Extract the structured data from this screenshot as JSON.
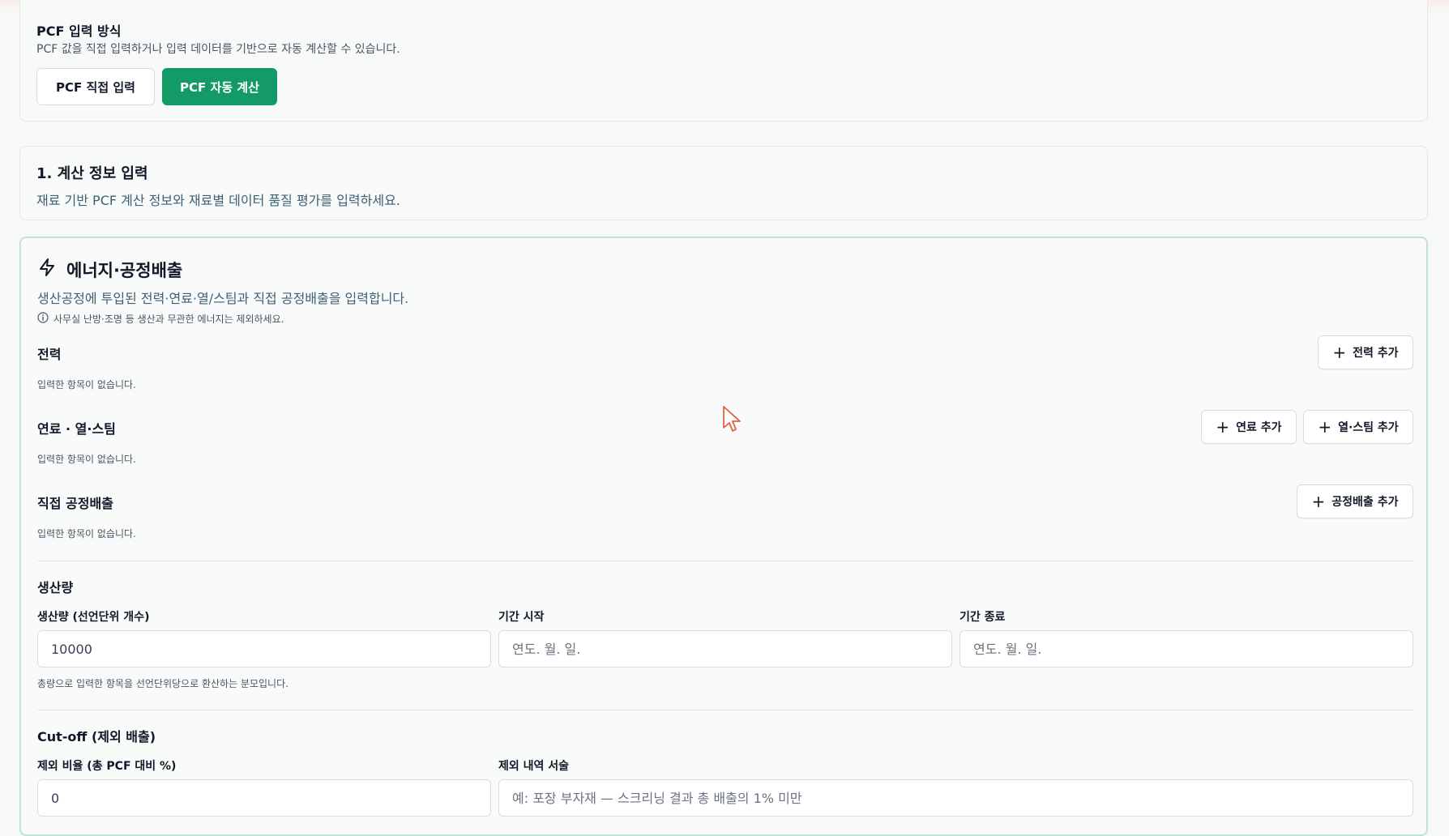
{
  "method": {
    "title": "PCF 입력 방식",
    "description": "PCF 값을 직접 입력하거나 입력 데이터를 기반으로 자동 계산할 수 있습니다.",
    "direct_button": "PCF 직접 입력",
    "auto_button": "PCF 자동 계산",
    "selected": "PCF 자동 계산",
    "accent_color": "#139a66"
  },
  "calc_info": {
    "title": "1. 계산 정보 입력",
    "description": "재료 기반 PCF 계산 정보와 재료별 데이터 품질 평가를 입력하세요."
  },
  "energy": {
    "icon": "lightning-icon",
    "title": "에너지·공정배출",
    "description": "생산공정에 투입된 전력·연료·열/스팀과 직접 공정배출을 입력합니다.",
    "note_icon": "info-icon",
    "note": "사무실 난방·조명 등 생산과 무관한 에너지는 제외하세요.",
    "electricity": {
      "label": "전력",
      "empty": "입력한 항목이 없습니다.",
      "add_button": "전력 추가"
    },
    "fuel": {
      "label": "연료 · 열·스팀",
      "empty": "입력한 항목이 없습니다.",
      "add_fuel_button": "연료 추가",
      "add_heat_button": "열·스팀 추가"
    },
    "process": {
      "label": "직접 공정배출",
      "empty": "입력한 항목이 없습니다.",
      "add_button": "공정배출 추가"
    }
  },
  "production": {
    "title": "생산량",
    "quantity_label": "생산량 (선언단위 개수)",
    "quantity_value": "10000",
    "start_label": "기간 시작",
    "start_placeholder": "연도. 월. 일.",
    "end_label": "기간 종료",
    "end_placeholder": "연도. 월. 일.",
    "hint": "총량으로 입력한 항목을 선언단위당으로 환산하는 분모입니다."
  },
  "cutoff": {
    "title": "Cut-off (제외 배출)",
    "ratio_label": "제외 비율 (총 PCF 대비 %)",
    "ratio_value": "0",
    "description_label": "제외 내역 서술",
    "description_placeholder": "예: 포장 부자재 — 스크리닝 결과 총 배출의 1% 미만"
  }
}
